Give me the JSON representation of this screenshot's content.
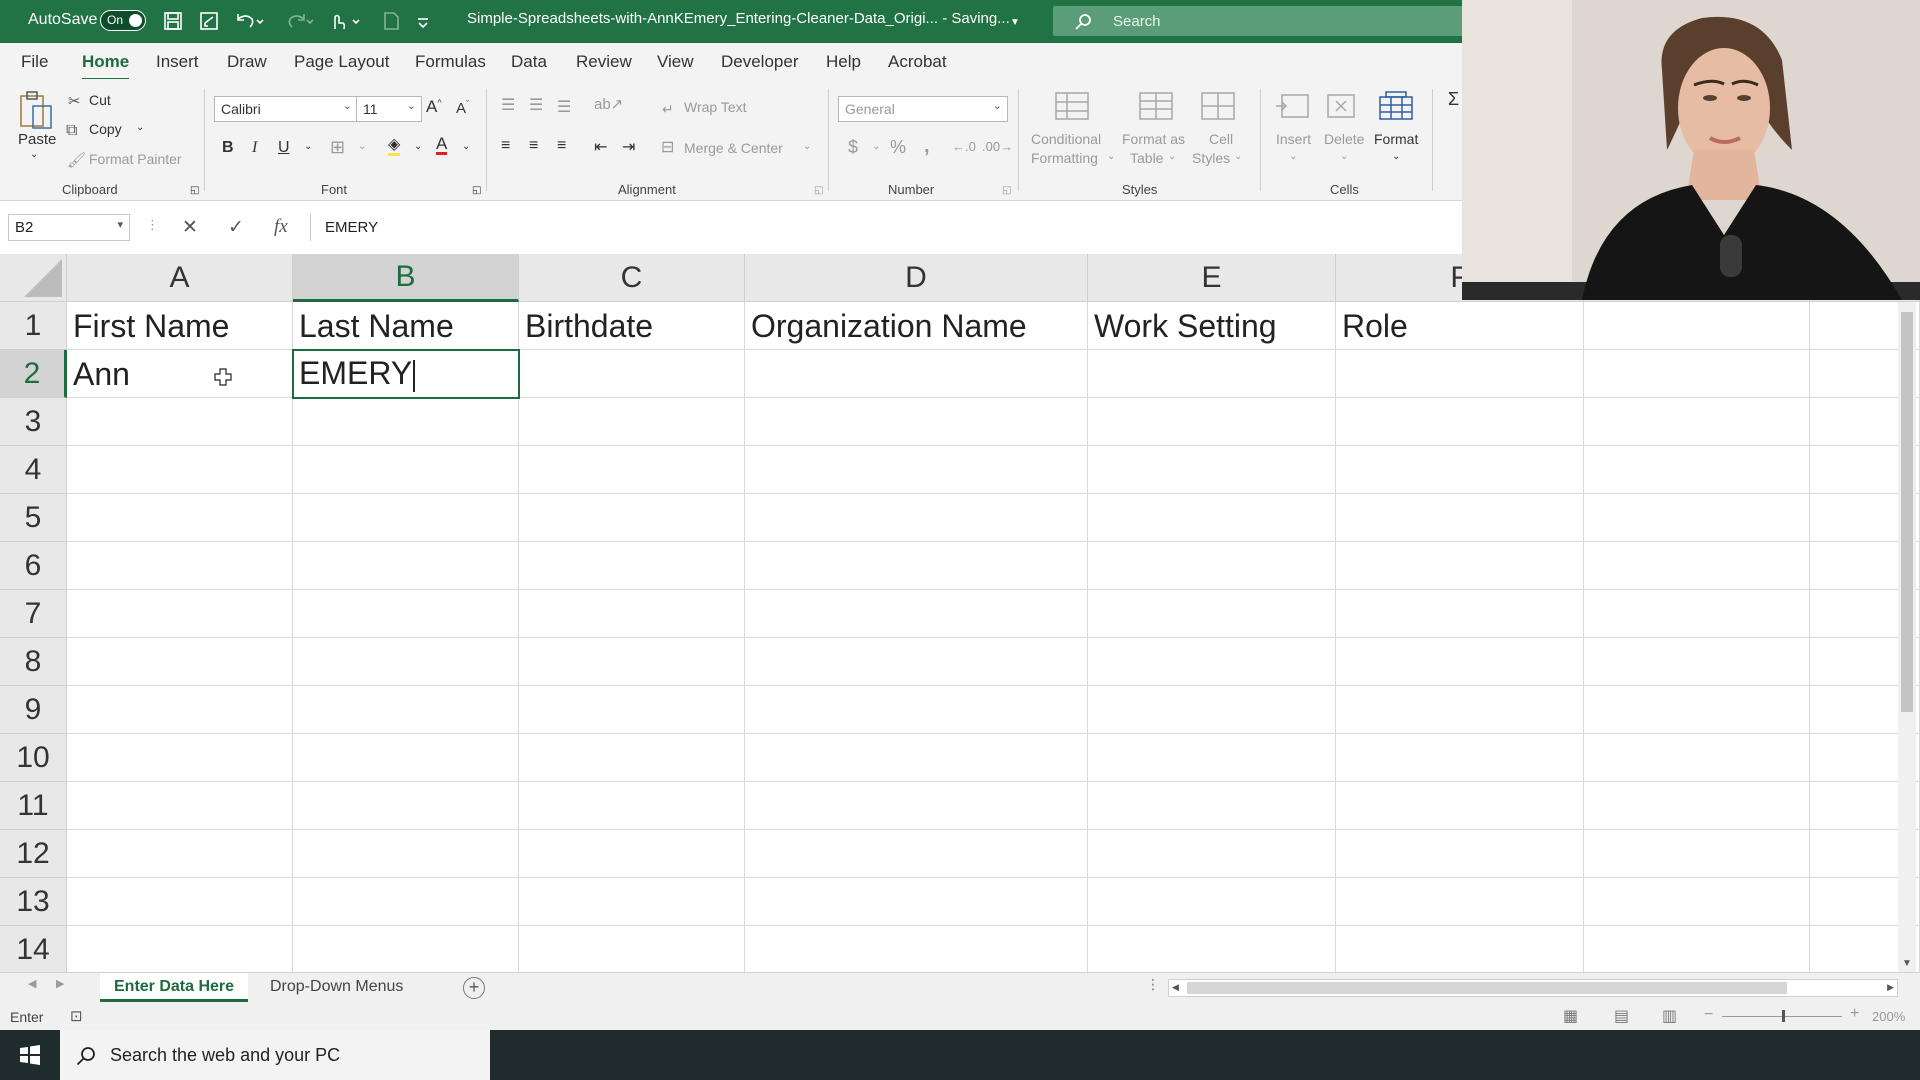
{
  "titlebar": {
    "autosave_label": "AutoSave",
    "autosave_state": "On",
    "document_title": "Simple-Spreadsheets-with-AnnKEmery_Entering-Cleaner-Data_Origi...  -  Saving...",
    "search_placeholder": "Search"
  },
  "menu": {
    "tabs": [
      "File",
      "Home",
      "Insert",
      "Draw",
      "Page Layout",
      "Formulas",
      "Data",
      "Review",
      "View",
      "Developer",
      "Help",
      "Acrobat"
    ],
    "active_tab": "Home"
  },
  "ribbon": {
    "clipboard": {
      "paste": "Paste",
      "cut": "Cut",
      "copy": "Copy",
      "format_painter": "Format Painter",
      "label": "Clipboard"
    },
    "font": {
      "font_name": "Calibri",
      "font_size": "11",
      "bold": "B",
      "italic": "I",
      "underline": "U",
      "label": "Font"
    },
    "alignment": {
      "wrap_text": "Wrap Text",
      "merge_center": "Merge & Center",
      "label": "Alignment"
    },
    "number": {
      "format": "General",
      "currency": "$",
      "percent": "%",
      "comma": ",",
      "label": "Number"
    },
    "styles": {
      "conditional_1": "Conditional",
      "conditional_2": "Formatting",
      "format_table_1": "Format as",
      "format_table_2": "Table",
      "cell_styles_1": "Cell",
      "cell_styles_2": "Styles",
      "label": "Styles"
    },
    "cells": {
      "insert": "Insert",
      "delete": "Delete",
      "format": "Format",
      "label": "Cells"
    }
  },
  "formula_bar": {
    "name_box": "B2",
    "fx": "fx",
    "content": "EMERY"
  },
  "grid": {
    "columns": [
      "A",
      "B",
      "C",
      "D",
      "E",
      "F"
    ],
    "selected_column": "B",
    "rows": [
      "1",
      "2",
      "3",
      "4",
      "5",
      "6",
      "7",
      "8",
      "9",
      "10",
      "11",
      "12",
      "13",
      "14"
    ],
    "selected_row": "2",
    "header_row": [
      "First Name",
      "Last Name",
      "Birthdate",
      "Organization Name",
      "Work Setting",
      "Role"
    ],
    "row2": {
      "a": "Ann",
      "b": "EMERY"
    }
  },
  "sheets": {
    "tabs": [
      "Enter Data Here",
      "Drop-Down Menus"
    ],
    "active": "Enter Data Here"
  },
  "status": {
    "mode": "Enter",
    "zoom": "200%"
  },
  "taskbar": {
    "search_placeholder": "Search the web and your PC"
  },
  "colors": {
    "excel_green": "#217346",
    "accent": "#1e6b3f"
  }
}
